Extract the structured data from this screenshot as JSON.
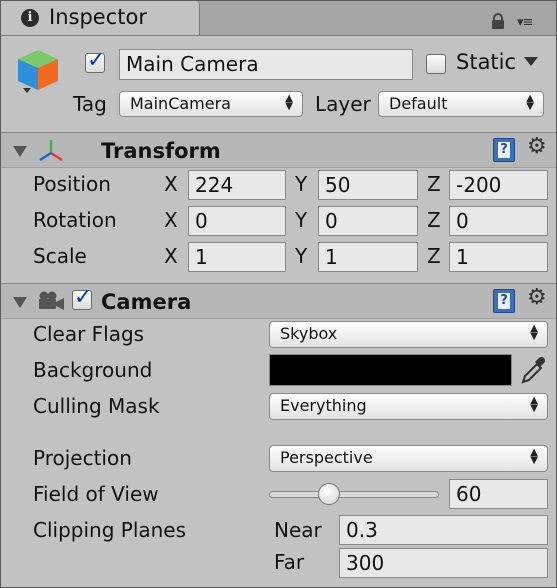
{
  "tab": {
    "title": "Inspector"
  },
  "object": {
    "active": true,
    "name": "Main Camera",
    "static_label": "Static",
    "static": false,
    "tag_label": "Tag",
    "tag_value": "MainCamera",
    "layer_label": "Layer",
    "layer_value": "Default"
  },
  "transform": {
    "title": "Transform",
    "rows": [
      {
        "label": "Position",
        "x": "224",
        "y": "50",
        "z": "-200"
      },
      {
        "label": "Rotation",
        "x": "0",
        "y": "0",
        "z": "0"
      },
      {
        "label": "Scale",
        "x": "1",
        "y": "1",
        "z": "1"
      }
    ],
    "axis_x": "X",
    "axis_y": "Y",
    "axis_z": "Z"
  },
  "camera": {
    "title": "Camera",
    "enabled": true,
    "clear_flags_label": "Clear Flags",
    "clear_flags_value": "Skybox",
    "background_label": "Background",
    "background_color": "#000000",
    "culling_mask_label": "Culling Mask",
    "culling_mask_value": "Everything",
    "projection_label": "Projection",
    "projection_value": "Perspective",
    "fov_label": "Field of View",
    "fov_value": "60",
    "clipping_label": "Clipping Planes",
    "near_label": "Near",
    "near_value": "0.3",
    "far_label": "Far",
    "far_value": "300"
  },
  "colors": {
    "panel_bg": "#c2c2c2",
    "header_bg": "#b7b7b7",
    "checkmark": "#0d3fa6",
    "help_blue": "#3e6fb6"
  }
}
